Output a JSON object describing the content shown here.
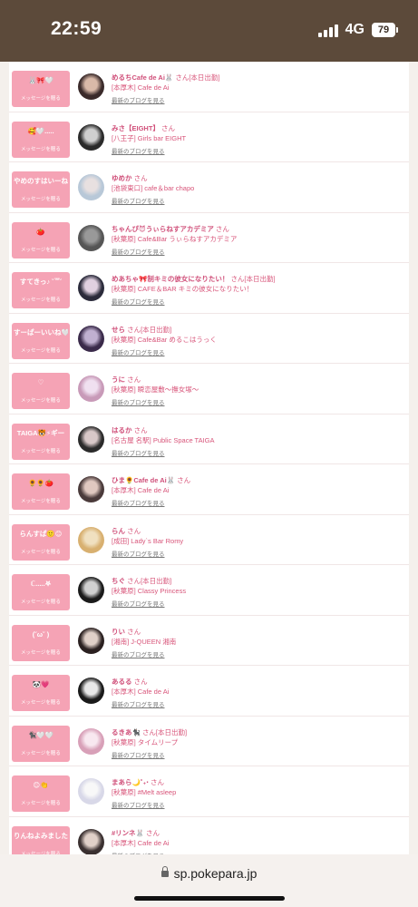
{
  "status_bar": {
    "time": "22:59",
    "network": "4G",
    "battery": "79"
  },
  "message_sub_label": "メッセージを贈る",
  "blog_link_label": "最新のブログを見る",
  "rows": [
    {
      "button_text": "🐰🎀🤍",
      "name": "めるちCafe de Ai🐰",
      "suffix": "さん[本日出勤]",
      "shop": "[本厚木] Cafe de Ai",
      "avatar": [
        "#3a2a2a",
        "#d9b9a8"
      ]
    },
    {
      "button_text": "🥰🤍.....",
      "name": "みさ【EIGHT】",
      "suffix": "さん",
      "shop": "[八王子] Girls bar EIGHT",
      "avatar": [
        "#2a2a2a",
        "#cfcfcf"
      ]
    },
    {
      "button_text": "やめのすはいーね！🌈",
      "name": "ゆめか",
      "suffix": "さん",
      "shop": "[池袋東口] cafe＆bar chapo",
      "avatar": [
        "#b8c8d8",
        "#e8e0e0"
      ]
    },
    {
      "button_text": "🍅",
      "name": "ちゃんぴ😈うぃらねすアカデミア",
      "suffix": "さん",
      "shop": "[秋葉原] Cafe&Bar うぃらねすアカデミア",
      "avatar": [
        "#555555",
        "#999999"
      ]
    },
    {
      "button_text": "すてきっ♪ ˘꒳˘",
      "name": "めあちゃ🎀制キミの彼女になりたい！",
      "suffix": "さん[本日出勤]",
      "shop": "[秋葉原] CAFE＆BAR キミの彼女になりたい！",
      "avatar": [
        "#2a2a3a",
        "#e0d0e0"
      ]
    },
    {
      "button_text": "すーぱーいいね🤍",
      "name": "せら",
      "suffix": "さん[本日出勤]",
      "shop": "[秋葉原] Cafe&Bar めるこはうっく",
      "avatar": [
        "#3a2a4a",
        "#c0b0d0"
      ]
    },
    {
      "button_text": "♡",
      "name": "うに",
      "suffix": "さん",
      "shop": "[秋葉原] 瞬恋屋敷〜撫女塚〜",
      "avatar": [
        "#c89ab8",
        "#f0e0f0"
      ]
    },
    {
      "button_text": "TAIGA🐯⚡ギー",
      "name": "はるか",
      "suffix": "さん",
      "shop": "[名古屋 名駅] Public Space TAIGA",
      "avatar": [
        "#2a2a2a",
        "#d8c8c8"
      ]
    },
    {
      "button_text": "🌻🌻🍅",
      "name": "ひま🌻Cafe de Ai🐰",
      "suffix": "さん",
      "shop": "[本厚木] Cafe de Ai",
      "avatar": [
        "#4a3a3a",
        "#e0c8c0"
      ]
    },
    {
      "button_text": "らんすぱ🙂😊",
      "name": "らん",
      "suffix": "さん",
      "shop": "[成田] Lady`s Bar Romy",
      "avatar": [
        "#d8b070",
        "#f0e0c0"
      ]
    },
    {
      "button_text": "ℂ.....𖤐",
      "name": "ちぐ",
      "suffix": "さん[本日出勤]",
      "shop": "[秋葉原] Classy Princess",
      "avatar": [
        "#1a1a1a",
        "#d0d0d0"
      ]
    },
    {
      "button_text": "(˘ω˘ )",
      "name": "りい",
      "suffix": "さん",
      "shop": "[湘南] J-QUEEN 湘南",
      "avatar": [
        "#2a2020",
        "#e0d0c8"
      ]
    },
    {
      "button_text": "🐼💗",
      "name": "あるる",
      "suffix": "さん",
      "shop": "[本厚木] Cafe de Ai",
      "avatar": [
        "#1a1a1a",
        "#e8e8e8"
      ]
    },
    {
      "button_text": "🐈‍⬛🤍🤍",
      "name": "るきあ🐈‍⬛",
      "suffix": "さん[本日出勤]",
      "shop": "[秋葉原] タイムリープ",
      "avatar": [
        "#d8a0b8",
        "#f8e8f0"
      ]
    },
    {
      "button_text": "😊👏",
      "name": "まあら🌙˚₊‧",
      "suffix": "さん",
      "shop": "[秋葉原] #Melt asleep",
      "avatar": [
        "#d8d8e8",
        "#f8f8f8"
      ]
    },
    {
      "button_text": "りんねよみました！",
      "name": "#リンネ🐰",
      "suffix": "さん",
      "shop": "[本厚木] Cafe de Ai",
      "avatar": [
        "#3a3030",
        "#e0d0c8"
      ]
    }
  ],
  "browser": {
    "url": "sp.pokepara.jp"
  }
}
